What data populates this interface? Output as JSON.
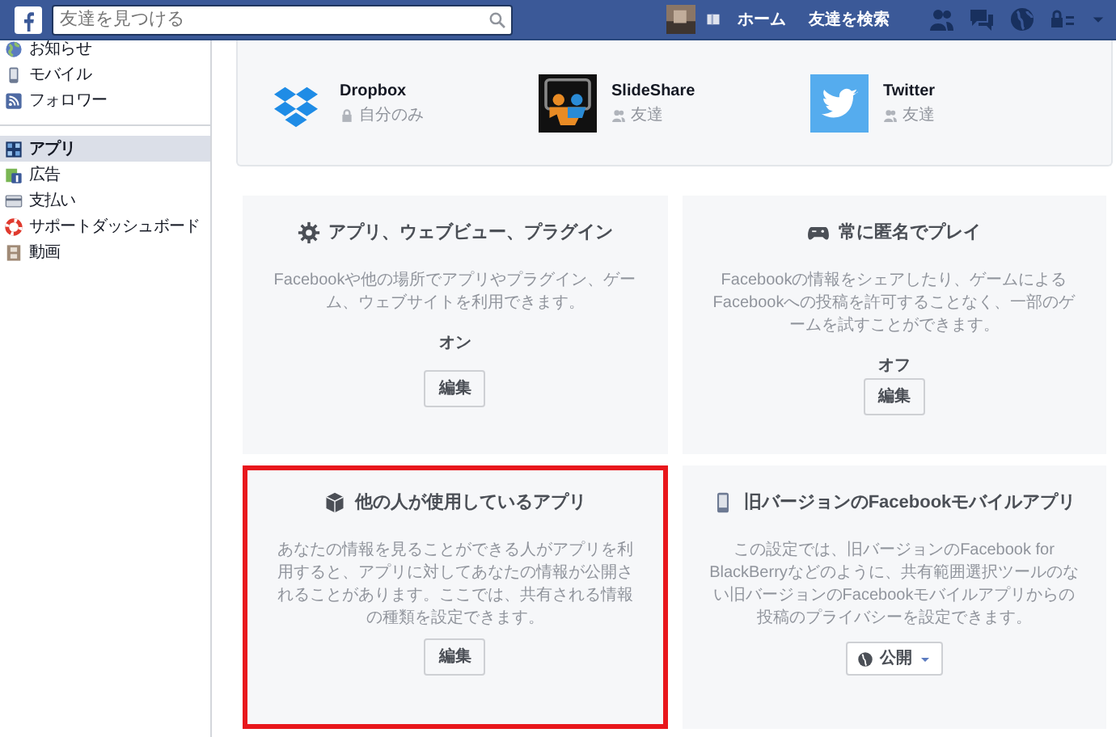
{
  "topbar": {
    "search": {
      "placeholder": "友達を見つける"
    },
    "links": [
      "ホーム",
      "友達を検索"
    ]
  },
  "sidebar": {
    "sections": [
      [
        {
          "label": "お知らせ",
          "selected": false
        },
        {
          "label": "モバイル",
          "selected": false
        },
        {
          "label": "フォロワー",
          "selected": false
        }
      ],
      [
        {
          "label": "アプリ",
          "selected": true
        },
        {
          "label": "広告",
          "selected": false
        },
        {
          "label": "支払い",
          "selected": false
        },
        {
          "label": "サポートダッシュボード",
          "selected": false
        },
        {
          "label": "動画",
          "selected": false
        }
      ]
    ]
  },
  "apps": [
    {
      "name": "Dropbox",
      "audience": "自分のみ"
    },
    {
      "name": "SlideShare",
      "audience": "友達"
    },
    {
      "name": "Twitter",
      "audience": "友達"
    }
  ],
  "cards": [
    {
      "title": "アプリ、ウェブビュー、プラグイン",
      "description": "Facebookや他の場所でアプリやプラグイン、ゲーム、ウェブサイトを利用できます。",
      "status": "オン",
      "control": {
        "kind": "button",
        "label": "編集"
      },
      "highlighted": false
    },
    {
      "title": "常に匿名でプレイ",
      "description": "Facebookの情報をシェアしたり、ゲームによるFacebookへの投稿を許可することなく、一部のゲームを試すことができます。",
      "status": "オフ",
      "control": {
        "kind": "button",
        "label": "編集"
      },
      "highlighted": false
    },
    {
      "title": "他の人が使用しているアプリ",
      "description": "あなたの情報を見ることができる人がアプリを利用すると、アプリに対してあなたの情報が公開されることがあります。ここでは、共有される情報の種類を設定できます。",
      "control": {
        "kind": "button",
        "label": "編集"
      },
      "highlighted": true
    },
    {
      "title": "旧バージョンのFacebookモバイルアプリ",
      "description": "この設定では、旧バージョンのFacebook for BlackBerryなどのように、共有範囲選択ツールのない旧バージョンのFacebookモバイルアプリからの投稿のプライバシーを設定できます。",
      "control": {
        "kind": "dropdown",
        "label": "公開"
      },
      "highlighted": false
    }
  ]
}
